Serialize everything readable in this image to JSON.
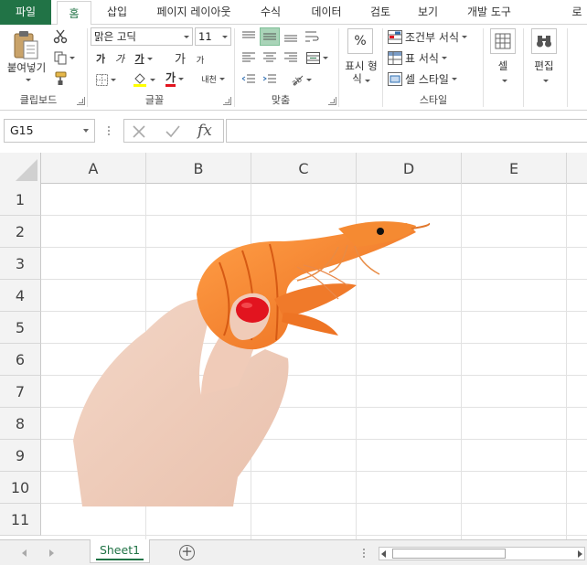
{
  "tabs": [
    {
      "label": "파일"
    },
    {
      "label": "홈"
    },
    {
      "label": "삽입"
    },
    {
      "label": "페이지 레이아웃"
    },
    {
      "label": "수식"
    },
    {
      "label": "데이터"
    },
    {
      "label": "검토"
    },
    {
      "label": "보기"
    },
    {
      "label": "개발 도구"
    },
    {
      "label": "로"
    }
  ],
  "ribbon": {
    "clipboard": {
      "paste_label": "붙여넣기",
      "group_label": "클립보드"
    },
    "font": {
      "font_name": "맑은 고딕",
      "font_size": "11",
      "bold": "가",
      "italic": "가",
      "underline": "가",
      "grow": "가",
      "shrink": "가",
      "font_color_glyph": "가",
      "phonetic": "내천",
      "group_label": "글꼴"
    },
    "alignment": {
      "group_label": "맞춤"
    },
    "number": {
      "percent": "%",
      "label_line1": "표시 형",
      "label_line2": "식",
      "group_label": ""
    },
    "styles": {
      "conditional": "조건부 서식",
      "table": "표 서식",
      "cell_style": "셀 스타일",
      "group_label": "스타일"
    },
    "cells": {
      "label": "셀"
    },
    "editing": {
      "label": "편집"
    }
  },
  "formula_bar": {
    "name_box": "G15",
    "fx": "fx",
    "formula": ""
  },
  "columns": [
    "A",
    "B",
    "C",
    "D",
    "E"
  ],
  "rows": [
    "1",
    "2",
    "3",
    "4",
    "5",
    "6",
    "7",
    "8",
    "9",
    "10",
    "11"
  ],
  "sheet": {
    "tab_name": "Sheet1",
    "add_symbol": "+"
  },
  "colors": {
    "brand": "#217346",
    "shrimp": "#f07a2a",
    "nail": "#e2141f"
  },
  "picture": {
    "icon_name": "hand-holding-shrimp-image"
  }
}
